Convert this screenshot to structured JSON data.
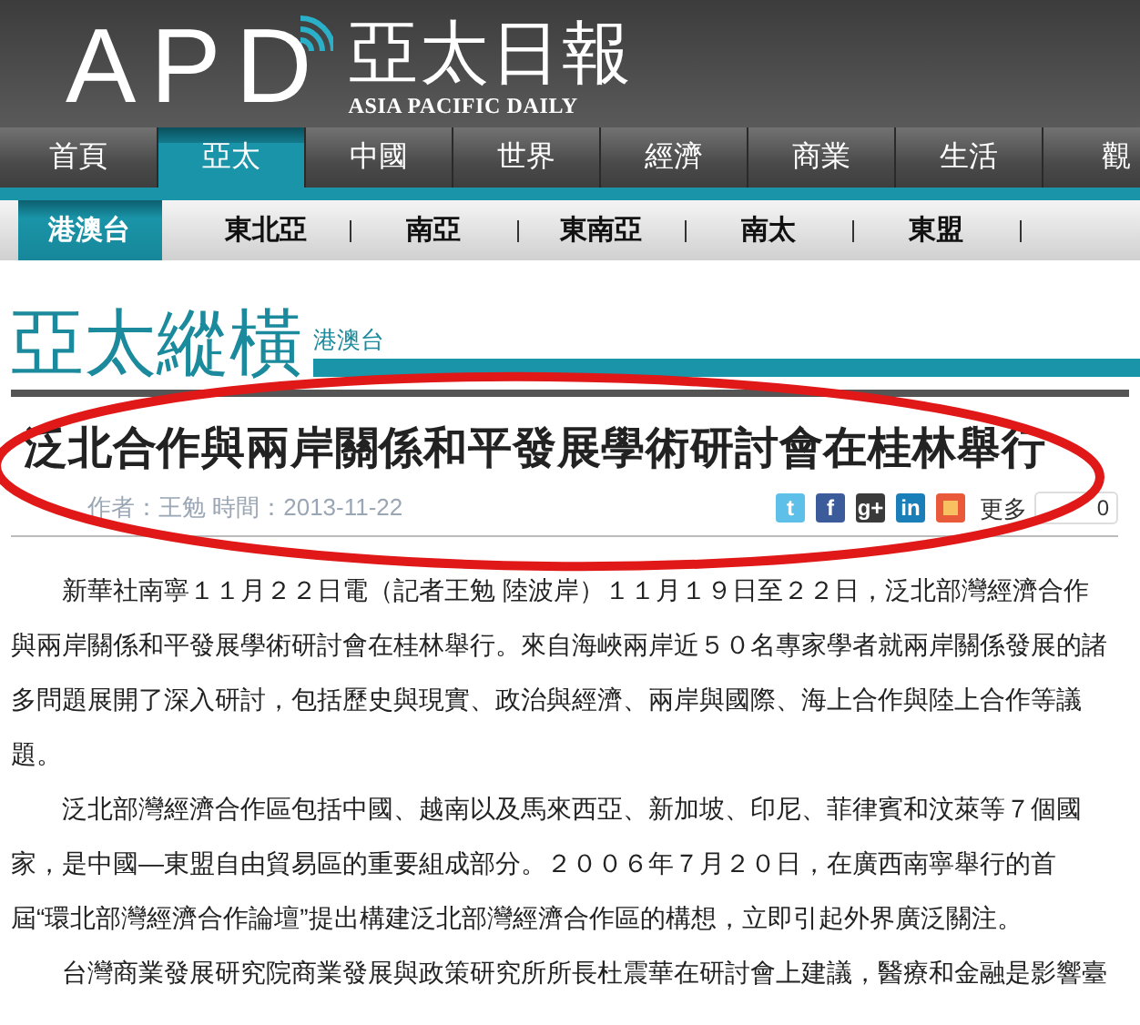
{
  "header": {
    "logo": "APD",
    "title": "亞太日報",
    "subtitle": "ASIA PACIFIC DAILY"
  },
  "nav": [
    {
      "label": "首頁",
      "selected": false
    },
    {
      "label": "亞太",
      "selected": true
    },
    {
      "label": "中國",
      "selected": false
    },
    {
      "label": "世界",
      "selected": false
    },
    {
      "label": "經濟",
      "selected": false
    },
    {
      "label": "商業",
      "selected": false
    },
    {
      "label": "生活",
      "selected": false
    },
    {
      "label": "觀",
      "selected": false
    }
  ],
  "subnav": [
    {
      "label": "港澳台",
      "selected": true
    },
    {
      "label": "東北亞",
      "selected": false
    },
    {
      "label": "南亞",
      "selected": false
    },
    {
      "label": "東南亞",
      "selected": false
    },
    {
      "label": "南太",
      "selected": false
    },
    {
      "label": "東盟",
      "selected": false
    }
  ],
  "section": {
    "title": "亞太縱橫",
    "tag": "港澳台"
  },
  "article": {
    "headline": "泛北合作與兩岸關係和平發展學術研討會在桂林舉行",
    "byline": "作者：王勉 時間：2013-11-22",
    "share": [
      {
        "kind": "twitter",
        "glyph": "t"
      },
      {
        "kind": "facebook",
        "glyph": "f"
      },
      {
        "kind": "googleplus",
        "glyph": "g+"
      },
      {
        "kind": "linkedin",
        "glyph": "in"
      },
      {
        "kind": "other"
      }
    ],
    "more": "更多",
    "count": "0",
    "paragraphs": [
      "新華社南寧１１月２２日電（記者王勉 陸波岸）１１月１９日至２２日，泛北部灣經濟合作與兩岸關係和平發展學術研討會在桂林舉行。來自海峽兩岸近５０名專家學者就兩岸關係發展的諸多問題展開了深入研討，包括歷史與現實、政治與經濟、兩岸與國際、海上合作與陸上合作等議題。",
      "泛北部灣經濟合作區包括中國、越南以及馬來西亞、新加坡、印尼、菲律賓和汶萊等７個國家，是中國—東盟自由貿易區的重要組成部分。２００６年７月２０日，在廣西南寧舉行的首屆“環北部灣經濟合作論壇”提出構建泛北部灣經濟合作區的構想，立即引起外界廣泛關注。",
      "台灣商業發展研究院商業發展與政策研究所所長杜震華在研討會上建議，醫療和金融是影響臺"
    ]
  },
  "annotation": {
    "kind": "ellipse"
  }
}
